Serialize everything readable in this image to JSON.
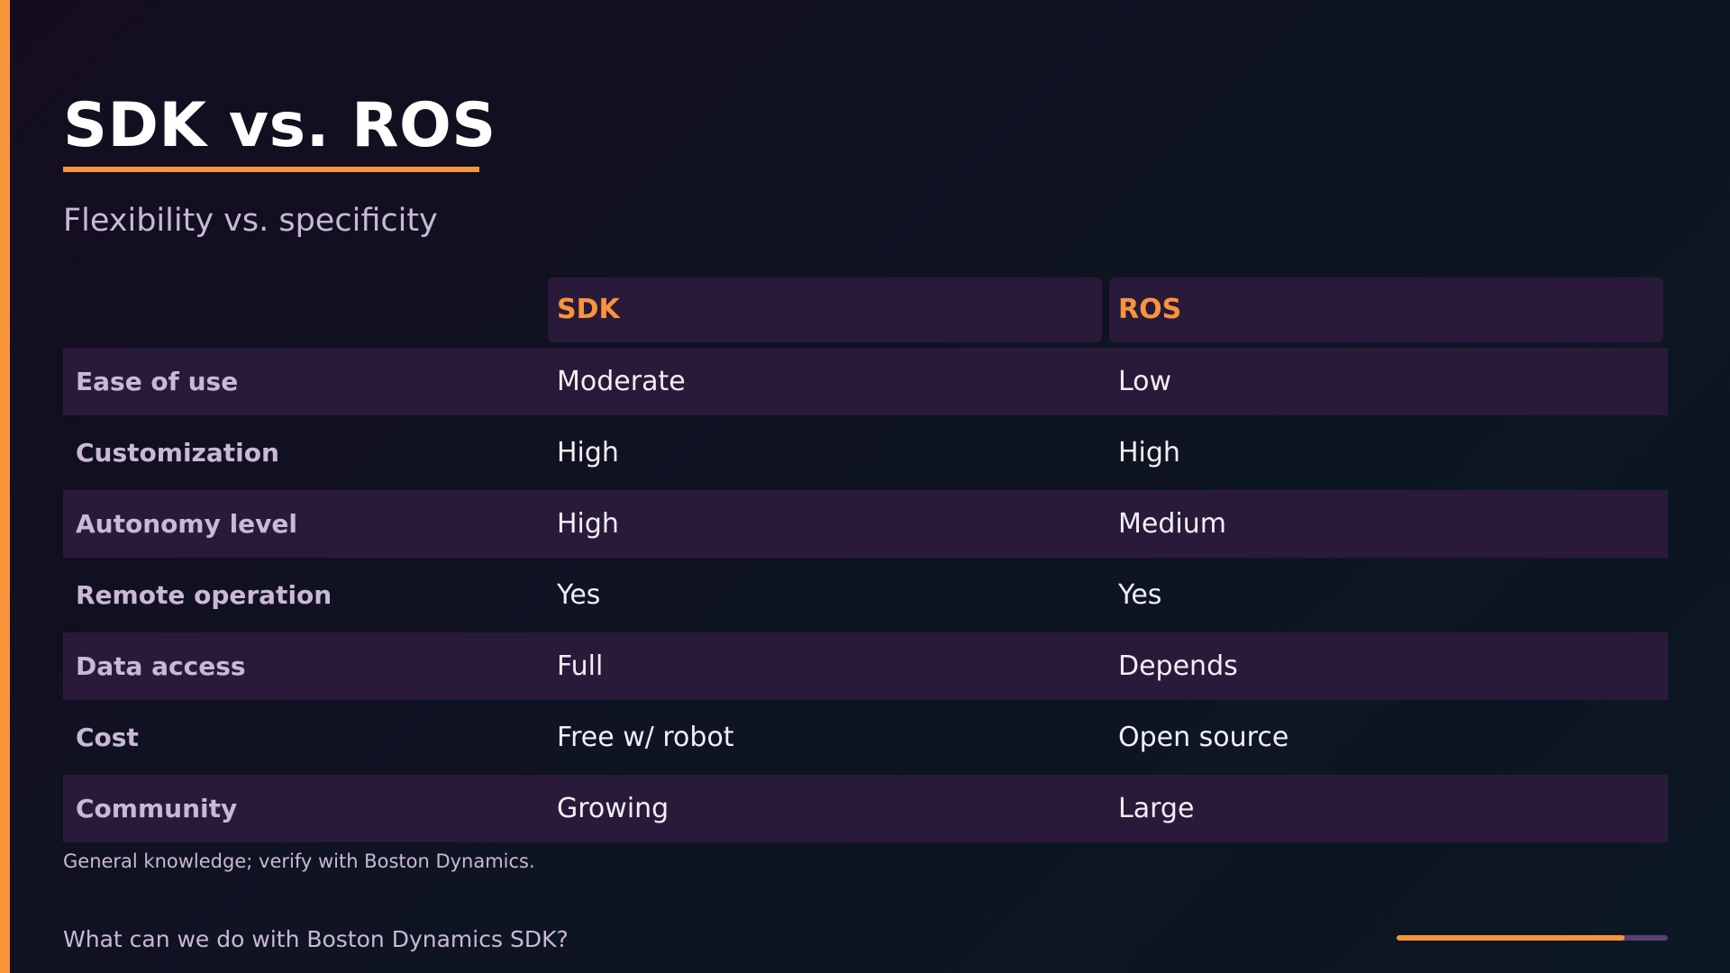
{
  "slide": {
    "title": "SDK vs. ROS",
    "subtitle": "Flexibility vs. specificity",
    "note": "General knowledge; verify with Boston Dynamics.",
    "footer": "What can we do with Boston Dynamics SDK?",
    "progress_fraction": 0.84
  },
  "table": {
    "headers": [
      "SDK",
      "ROS"
    ],
    "rows": [
      {
        "label": "Ease of use",
        "sdk": "Moderate",
        "ros": "Low"
      },
      {
        "label": "Customization",
        "sdk": "High",
        "ros": "High"
      },
      {
        "label": "Autonomy level",
        "sdk": "High",
        "ros": "Medium"
      },
      {
        "label": "Remote operation",
        "sdk": "Yes",
        "ros": "Yes"
      },
      {
        "label": "Data access",
        "sdk": "Full",
        "ros": "Depends"
      },
      {
        "label": "Cost",
        "sdk": "Free w/ robot",
        "ros": "Open source"
      },
      {
        "label": "Community",
        "sdk": "Growing",
        "ros": "Large"
      }
    ]
  },
  "colors": {
    "accent": "#f7943c",
    "row_shade": "#2a1a3a",
    "muted_text": "#c9b8d6",
    "progress_track": "#5a3f74"
  }
}
